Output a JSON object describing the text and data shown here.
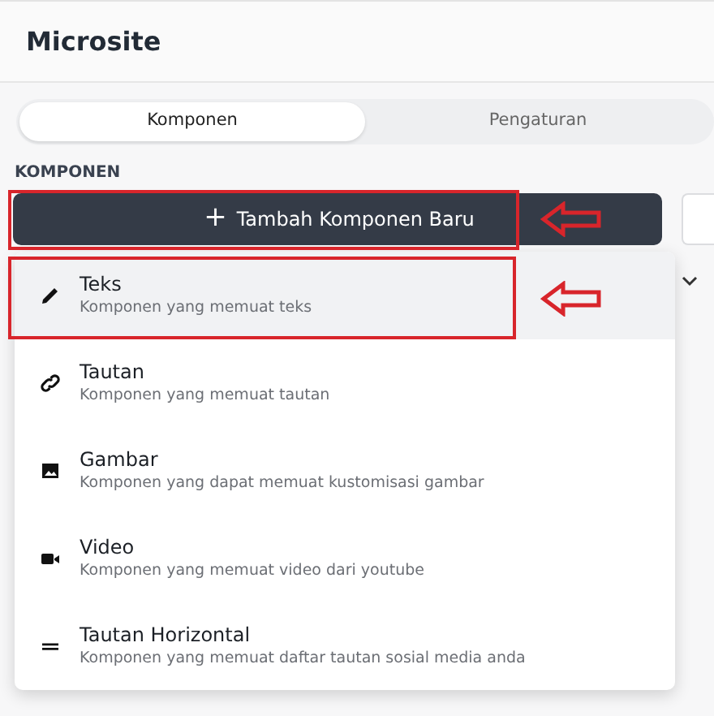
{
  "header": {
    "title": "Microsite"
  },
  "tabs": [
    {
      "label": "Komponen",
      "selected": true
    },
    {
      "label": "Pengaturan",
      "selected": false
    }
  ],
  "section_label": "KOMPONEN",
  "add_button": {
    "icon": "+",
    "label": "Tambah Komponen Baru",
    "highlighted": true
  },
  "menu": [
    {
      "kind": "text",
      "title": "Teks",
      "description": "Komponen yang memuat teks",
      "selected": true,
      "highlighted": true
    },
    {
      "kind": "link",
      "title": "Tautan",
      "description": "Komponen yang memuat tautan",
      "selected": false,
      "highlighted": false
    },
    {
      "kind": "image",
      "title": "Gambar",
      "description": "Komponen yang dapat memuat kustomisasi gambar",
      "selected": false,
      "highlighted": false
    },
    {
      "kind": "video",
      "title": "Video",
      "description": "Komponen yang memuat video dari youtube",
      "selected": false,
      "highlighted": false
    },
    {
      "kind": "links-horizontal",
      "title": "Tautan Horizontal",
      "description": "Komponen yang memuat daftar tautan sosial media anda",
      "selected": false,
      "highlighted": false
    }
  ]
}
